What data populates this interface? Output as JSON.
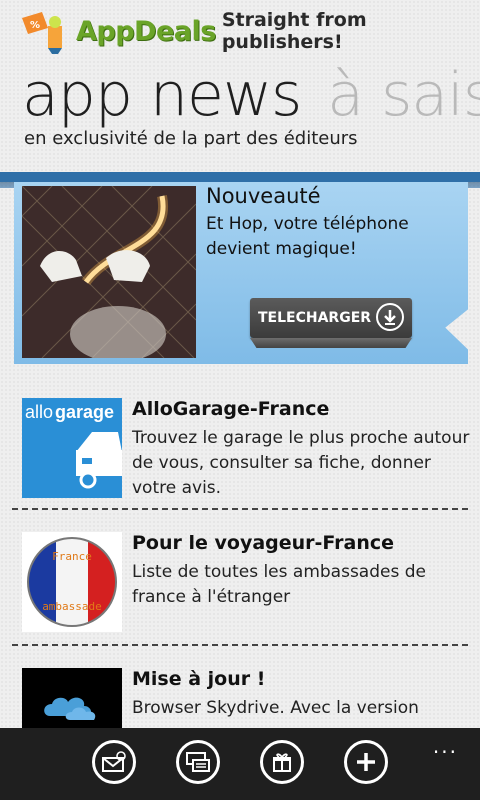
{
  "header": {
    "brand": "AppDeals",
    "tagline": "Straight from publishers!",
    "title_main": "app news",
    "title_next": "à sais",
    "subtitle": "en exclusivité de la part des éditeurs"
  },
  "featured": {
    "title": "Nouveauté",
    "description": "Et Hop, votre téléphone devient magique!",
    "button_label": "TELECHARGER"
  },
  "items": [
    {
      "title": "AlloGarage-France",
      "description": "Trouvez le garage le plus proche autour de vous, consulter sa fiche, donner votre avis.",
      "logo_text_1": "allo",
      "logo_text_2": "garage"
    },
    {
      "title": "Pour le voyageur-France",
      "description": "Liste de toutes les ambassades de france à l'étranger",
      "badge_top": "France",
      "badge_bottom": "ambassade"
    },
    {
      "title": "Mise à jour !",
      "description": "Browser Skydrive. Avec la version"
    }
  ],
  "appbar": {
    "more": "...",
    "icons": [
      "mail-icon",
      "multitask-icon",
      "gift-icon",
      "add-icon"
    ]
  },
  "colors": {
    "brand_green": "#6aa428",
    "band_blue": "#2f6fa8",
    "feature_bg": "#a9d4f2",
    "garage_blue": "#2a8fd6"
  }
}
